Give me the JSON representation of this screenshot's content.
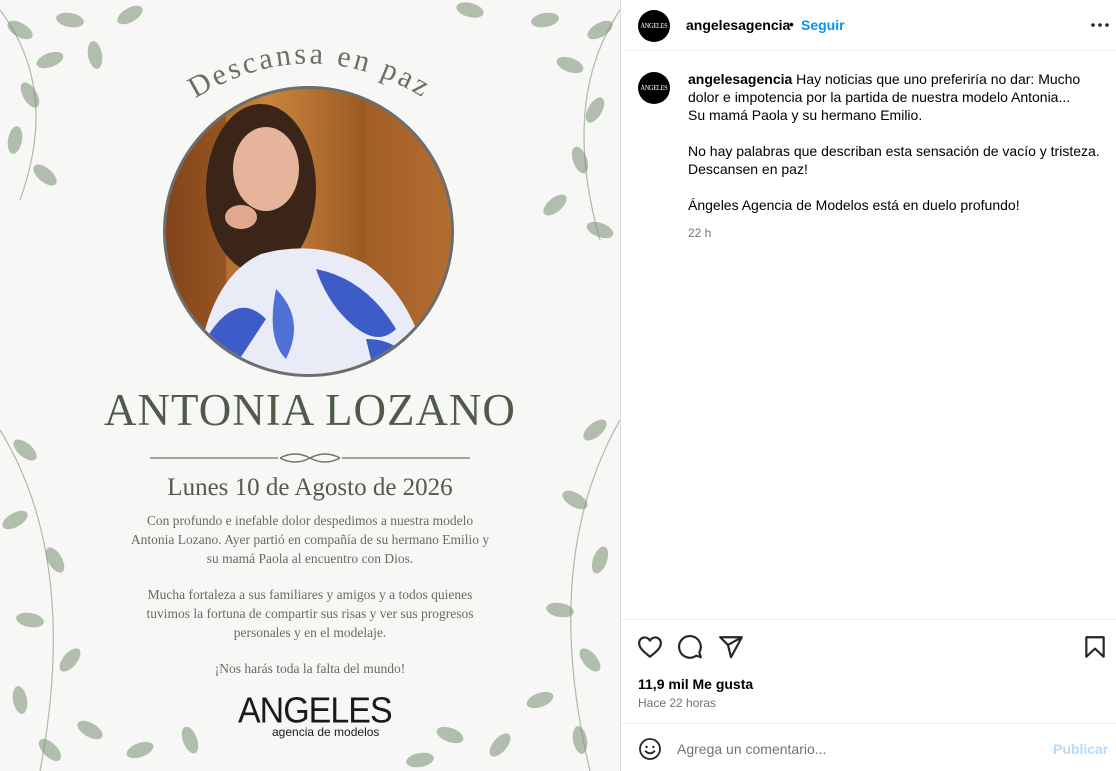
{
  "card": {
    "arc_title": "Descansa en paz",
    "name": "ANTONIA LOZANO",
    "date": "Lunes 10 de Agosto de 2026",
    "paragraph1": [
      "Con profundo e inefable dolor despedimos a nuestra modelo",
      "Antonia Lozano. Ayer partió en compañía de su hermano Emilio y",
      "su mamá Paola al encuentro con Dios."
    ],
    "paragraph2": [
      "Mucha fortaleza a sus familiares y amigos y a todos quienes",
      "tuvimos la fortuna de compartir sus risas y ver sus progresos",
      "personales y en el modelaje."
    ],
    "paragraph3": [
      "¡Nos harás toda la falta del mundo!"
    ],
    "logo_word": "ANGELES",
    "logo_sub": "agencia de modelos"
  },
  "header": {
    "avatar_text": "ÁNGELES",
    "username": "angelesagencia",
    "dot": "•",
    "follow_label": "Seguir"
  },
  "caption": {
    "username": "angelesagencia",
    "lines": [
      "Hay noticias que uno preferiría no dar: Mucho",
      "dolor e impotencia por la partida de nuestra modelo Antonia...",
      "Su mamá Paola y su hermano Emilio.",
      "",
      "No hay palabras que describan esta sensación de vacío y tristeza.",
      "Descansen en paz!",
      "",
      "Ángeles Agencia de Modelos está en duelo profundo!"
    ],
    "time": "22 h"
  },
  "actions": {
    "likes": "11,9 mil Me gusta",
    "age": "Hace 22 horas"
  },
  "comment": {
    "placeholder": "Agrega un comentario...",
    "publish_label": "Publicar"
  },
  "colors": {
    "accent": "#0095f6",
    "publish_disabled": "#b3dbff",
    "muted_text": "#737373"
  }
}
